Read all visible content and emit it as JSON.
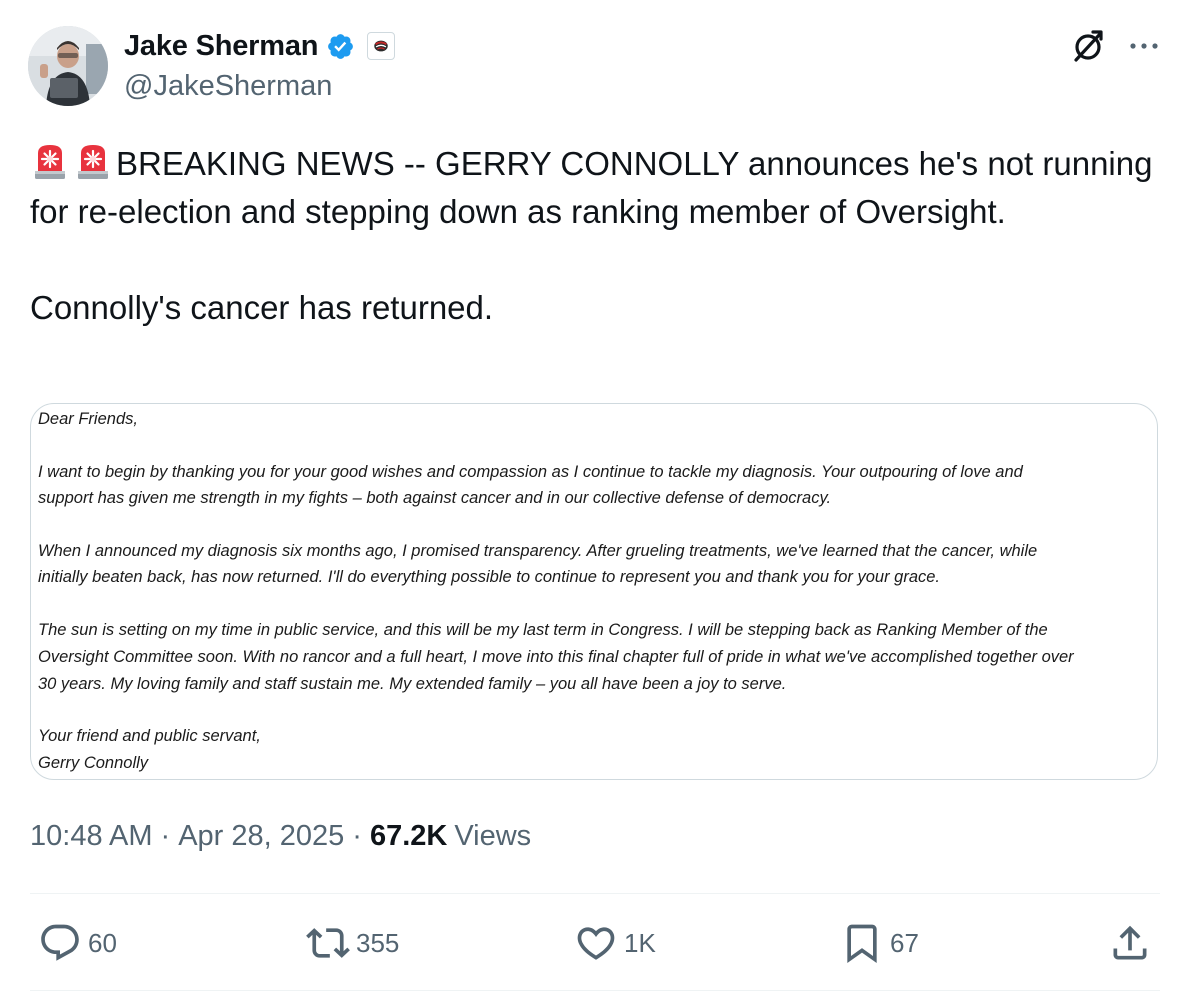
{
  "author": {
    "display_name": "Jake Sherman",
    "handle": "@JakeSherman"
  },
  "tweet": {
    "line_text": "BREAKING NEWS -- GERRY CONNOLLY announces he's not running for re-election and stepping down as ranking member of Oversight.\n\nConnolly's cancer has returned."
  },
  "letter": {
    "salutation": "Dear Friends,",
    "para1_line1": "I want to begin by thanking you for your good wishes and compassion as I continue to tackle my diagnosis. Your outpouring of love and",
    "para1_line2": "support has given me strength in my fights – both against cancer and in our collective defense of democracy.",
    "para2_line1": "When I announced my diagnosis six months ago, I promised transparency. After grueling treatments, we've learned that the cancer, while",
    "para2_line2": "initially beaten back, has now returned. I'll do everything possible to continue to represent you and thank you for your grace.",
    "para3_line1": "The sun is setting on my time in public service, and this will be my last term in Congress. I will be stepping back as Ranking Member of the",
    "para3_line2": "Oversight Committee soon. With no rancor and a full heart, I move into this final chapter full of pride in what we've accomplished together over",
    "para3_line3": "30 years. My loving family and staff sustain me. My extended family – you all have been a joy to serve.",
    "closing": "Your friend and public servant,",
    "signature": "Gerry Connolly"
  },
  "meta": {
    "time": "10:48 AM",
    "separator": "·",
    "date": "Apr 28, 2025",
    "views_count": "67.2K",
    "views_label": "Views"
  },
  "actions": {
    "replies": "60",
    "reposts": "355",
    "likes": "1K",
    "bookmarks": "67"
  },
  "icons": {
    "emoji": "police-car-light-emoji",
    "verified": "verified-badge-icon",
    "affiliate": "affiliate-badge-icon"
  },
  "colors": {
    "verified_blue": "#1d9bf0",
    "siren_red": "#e8333e",
    "secondary_text": "#536471"
  }
}
